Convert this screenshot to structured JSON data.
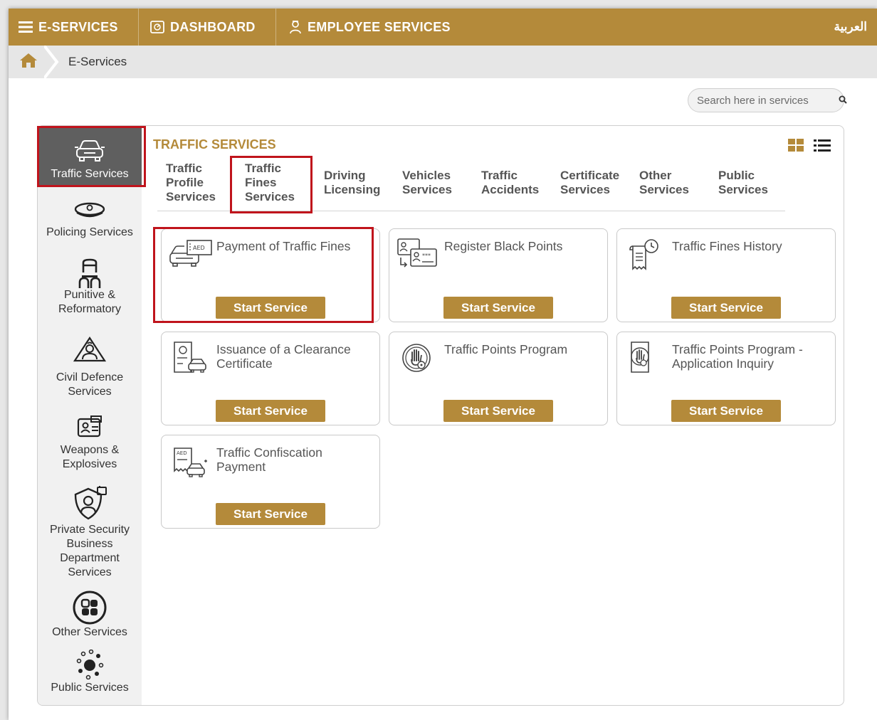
{
  "topnav": {
    "eservices_label": "E-SERVICES",
    "dashboard_label": "DASHBOARD",
    "employee_services_label": "EMPLOYEE SERVICES",
    "language_label": "العربية"
  },
  "breadcrumb": {
    "current": "E-Services"
  },
  "search": {
    "placeholder": "Search here in services"
  },
  "sidebar": {
    "items": [
      {
        "label": "Traffic Services",
        "icon": "car-icon",
        "active": true
      },
      {
        "label": "Policing Services",
        "icon": "police-cap-icon"
      },
      {
        "label": "Punitive & Reformatory",
        "icon": "prison-icon"
      },
      {
        "label": "Civil Defence Services",
        "icon": "fire-helmet-icon"
      },
      {
        "label": "Weapons & Explosives",
        "icon": "id-card-icon"
      },
      {
        "label": "Private Security Business Department Services",
        "icon": "security-guard-icon"
      },
      {
        "label": "Other Services",
        "icon": "grid-circle-icon"
      },
      {
        "label": "Public Services",
        "icon": "network-icon"
      }
    ]
  },
  "content": {
    "title": "TRAFFIC SERVICES",
    "tabs": [
      {
        "label": "Traffic Profile Services"
      },
      {
        "label": "Traffic Fines Services",
        "active": true
      },
      {
        "label": "Driving Licensing"
      },
      {
        "label": "Vehicles Services"
      },
      {
        "label": "Traffic Accidents"
      },
      {
        "label": "Certificate Services"
      },
      {
        "label": "Other Services"
      },
      {
        "label": "Public Services"
      }
    ],
    "cards": [
      {
        "title": "Payment of Traffic Fines",
        "icon": "car-fine-aed-icon",
        "button": "Start Service"
      },
      {
        "title": "Register Black Points",
        "icon": "id-cards-icon",
        "button": "Start Service"
      },
      {
        "title": "Traffic Fines History",
        "icon": "history-receipt-icon",
        "button": "Start Service"
      },
      {
        "title": "Issuance of a Clearance Certificate",
        "icon": "certificate-car-icon",
        "button": "Start Service"
      },
      {
        "title": "Traffic Points Program",
        "icon": "hand-stop-icon",
        "button": "Start Service"
      },
      {
        "title": "Traffic Points Program - Application Inquiry",
        "icon": "hand-document-icon",
        "button": "Start Service"
      },
      {
        "title": "Traffic Confiscation Payment",
        "icon": "receipt-car-aed-icon",
        "button": "Start Service"
      }
    ]
  },
  "colors": {
    "brand": "#b48a3a",
    "highlight": "#c0141c",
    "sidebar_active": "#5f5f5f"
  }
}
